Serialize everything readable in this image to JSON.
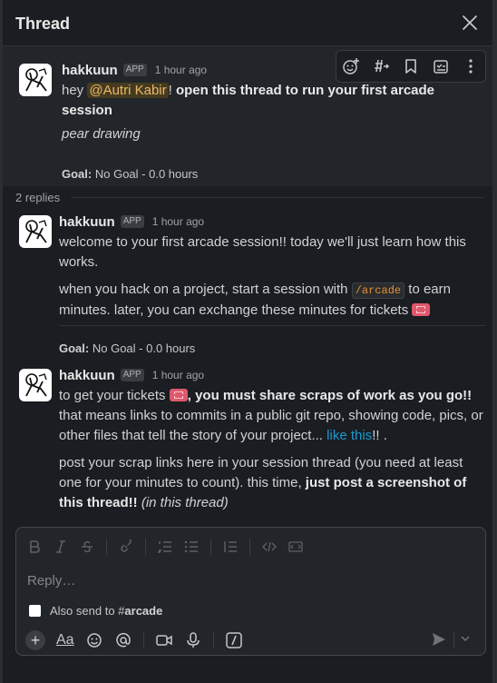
{
  "header": {
    "title": "Thread"
  },
  "parent_message": {
    "author": "hakkuun",
    "badge": "APP",
    "time": "1 hour ago",
    "text_hey": "hey",
    "mention": "@Autri Kabir",
    "text_bang": "!",
    "text_bold": "open this thread to run your first arcade session",
    "italic_line": "pear drawing",
    "goal_label": "Goal:",
    "goal_value": "No Goal - 0.0 hours"
  },
  "replies_count": "2 replies",
  "reply1": {
    "author": "hakkuun",
    "badge": "APP",
    "time": "1 hour ago",
    "p1": "welcome to your first arcade session!! today we'll just learn how this works.",
    "p2_before": "when you hack on a project, start a session with",
    "p2_code": "/arcade",
    "p2_after": "to earn minutes. later, you can exchange these minutes for tickets",
    "goal_label": "Goal:",
    "goal_value": "No Goal - 0.0 hours"
  },
  "reply2": {
    "author": "hakkuun",
    "badge": "APP",
    "time": "1 hour ago",
    "p1_a": "to get your tickets",
    "p1_bold": ", you must share scraps of work as you go!!",
    "p1_b": "that means links to commits in a public git repo, showing code, pics, or other files that tell the story of your project...",
    "p1_link": "like this",
    "p1_end": "!! .",
    "p2_a": "post your scrap links here in your session thread (you need at least one for your minutes to count). this time,",
    "p2_bold": "just post a screenshot of this thread!!",
    "p2_ital": "(in this thread)"
  },
  "composer": {
    "placeholder": "Reply…",
    "also_send": "Also send to",
    "channel_prefix": "#",
    "channel": "arcade",
    "aa": "Aa"
  },
  "icons": [
    "close-icon",
    "emoji-reaction-icon",
    "channel-forward-icon",
    "bookmark-icon",
    "task-icon",
    "more-vertical-icon",
    "bold-icon",
    "italic-icon",
    "strikethrough-icon",
    "link-icon",
    "ordered-list-icon",
    "bullet-list-icon",
    "block-quote-icon",
    "code-icon",
    "code-block-icon",
    "plus-icon",
    "emoji-icon",
    "mention-icon",
    "video-icon",
    "microphone-icon",
    "slash-command-icon",
    "send-icon",
    "chevron-down-icon"
  ],
  "colors": {
    "background": "#1a1d21",
    "mention_bg": "#463b1f",
    "mention_text": "#e8b868",
    "link": "#1d9bd1",
    "code": "#e8912d"
  }
}
